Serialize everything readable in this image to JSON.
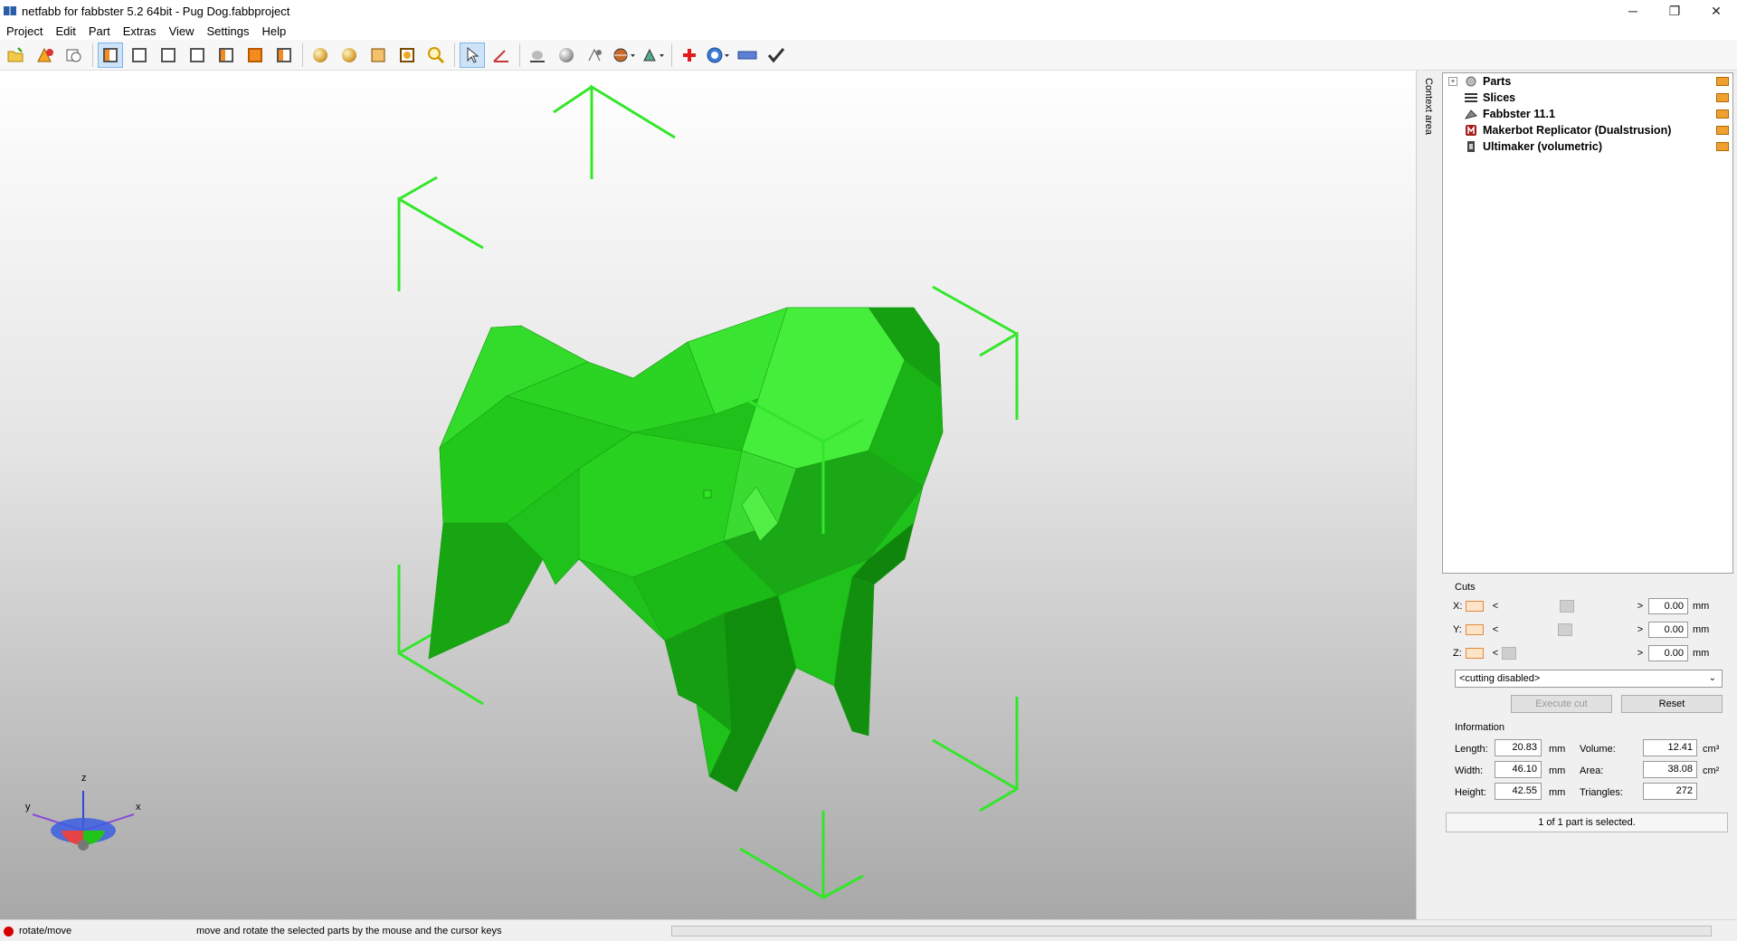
{
  "window": {
    "title": "netfabb for fabbster 5.2 64bit - Pug Dog.fabbproject",
    "controls": {
      "minimize": "─",
      "restore": "❐",
      "close": "✕"
    }
  },
  "menu": [
    "Project",
    "Edit",
    "Part",
    "Extras",
    "View",
    "Settings",
    "Help"
  ],
  "toolbar": {
    "icons": [
      "open-project-icon",
      "add-part-icon",
      "add-slice-icon",
      "view-front-icon",
      "view-back-icon",
      "view-left-icon",
      "view-right-icon",
      "view-top-icon",
      "view-bottom-icon",
      "view-iso-icon",
      "shaded-view-icon",
      "solid-view-icon",
      "wireframe-icon",
      "box-view-icon",
      "zoom-icon",
      "select-pointer-icon",
      "measure-angle-icon",
      "align-icon",
      "sphere-icon",
      "perspective-icon",
      "section-icon",
      "render-options-icon",
      "add-support-icon",
      "repair-icon",
      "ruler-icon",
      "check-icon"
    ]
  },
  "context_tab": "Context area",
  "tree": {
    "items": [
      {
        "label": "Parts",
        "icon": "parts-icon"
      },
      {
        "label": "Slices",
        "icon": "slices-icon"
      },
      {
        "label": "Fabbster 11.1",
        "icon": "fabbster-printer-icon"
      },
      {
        "label": "Makerbot Replicator (Dualstrusion)",
        "icon": "makerbot-icon"
      },
      {
        "label": "Ultimaker (volumetric)",
        "icon": "ultimaker-icon"
      }
    ]
  },
  "cuts": {
    "title": "Cuts",
    "axes": [
      {
        "label": "X:",
        "value": "0.00",
        "unit": "mm",
        "position": 0.5
      },
      {
        "label": "Y:",
        "value": "0.00",
        "unit": "mm",
        "position": 0.5
      },
      {
        "label": "Z:",
        "value": "0.00",
        "unit": "mm",
        "position": 0.0
      }
    ],
    "mode": "<cutting disabled>",
    "execute_label": "Execute cut",
    "reset_label": "Reset"
  },
  "information": {
    "title": "Information",
    "length_label": "Length:",
    "length": "20.83",
    "length_unit": "mm",
    "width_label": "Width:",
    "width": "46.10",
    "width_unit": "mm",
    "height_label": "Height:",
    "height": "42.55",
    "height_unit": "mm",
    "volume_label": "Volume:",
    "volume": "12.41",
    "volume_unit": "cm³",
    "area_label": "Area:",
    "area": "38.08",
    "area_unit": "cm²",
    "triangles_label": "Triangles:",
    "triangles": "272"
  },
  "selection_status": "1 of 1 part is selected.",
  "axes_gizmo": {
    "z": "z",
    "y": "y",
    "x": "x"
  },
  "status": {
    "mode": "rotate/move",
    "hint": "move and rotate the selected parts by the mouse and the cursor keys"
  },
  "colors": {
    "model": "#22c41a",
    "bracket": "#33e62a",
    "folder": "#f0a030",
    "status_dot": "#d40000"
  }
}
